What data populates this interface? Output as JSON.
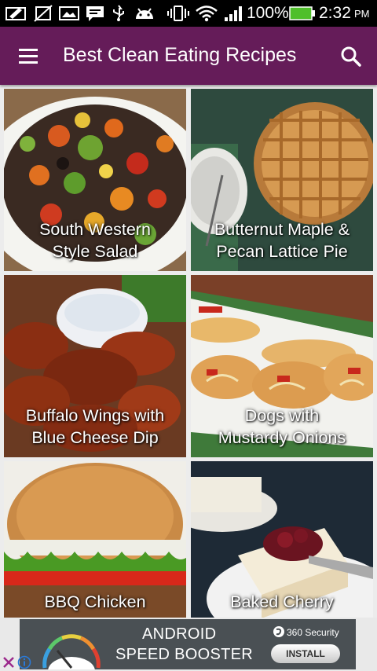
{
  "status_bar": {
    "battery_percent": "100%",
    "time": "2:32",
    "am_pm": "PM"
  },
  "app_bar": {
    "title": "Best Clean Eating Recipes",
    "menu_icon": "hamburger-menu-icon",
    "search_icon": "search-icon",
    "color": "#651c59"
  },
  "recipes": [
    {
      "line1": "South Western",
      "line2": "Style Salad"
    },
    {
      "line1": "Butternut Maple &",
      "line2": "Pecan Lattice Pie"
    },
    {
      "line1": "Buffalo Wings with",
      "line2": "Blue Cheese Dip"
    },
    {
      "line1": "Dogs with",
      "line2": "Mustardy Onions"
    },
    {
      "line1": "BBQ Chicken",
      "line2": ""
    },
    {
      "line1": "Baked Cherry",
      "line2": ""
    }
  ],
  "ad": {
    "title": "ANDROID",
    "subtitle": "SPEED BOOSTER",
    "brand": "360 Security",
    "button": "INSTALL"
  }
}
